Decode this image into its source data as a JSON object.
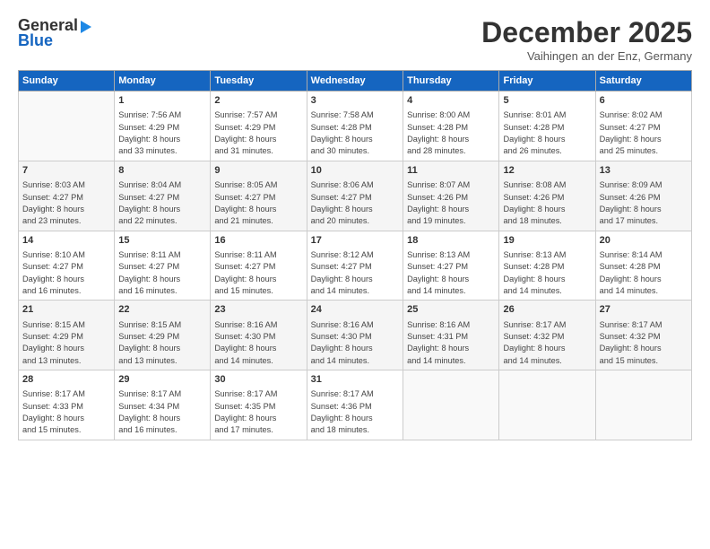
{
  "header": {
    "logo_top": "General",
    "logo_bottom": "Blue",
    "month": "December 2025",
    "location": "Vaihingen an der Enz, Germany"
  },
  "days_of_week": [
    "Sunday",
    "Monday",
    "Tuesday",
    "Wednesday",
    "Thursday",
    "Friday",
    "Saturday"
  ],
  "weeks": [
    [
      {
        "num": "",
        "info": ""
      },
      {
        "num": "1",
        "info": "Sunrise: 7:56 AM\nSunset: 4:29 PM\nDaylight: 8 hours\nand 33 minutes."
      },
      {
        "num": "2",
        "info": "Sunrise: 7:57 AM\nSunset: 4:29 PM\nDaylight: 8 hours\nand 31 minutes."
      },
      {
        "num": "3",
        "info": "Sunrise: 7:58 AM\nSunset: 4:28 PM\nDaylight: 8 hours\nand 30 minutes."
      },
      {
        "num": "4",
        "info": "Sunrise: 8:00 AM\nSunset: 4:28 PM\nDaylight: 8 hours\nand 28 minutes."
      },
      {
        "num": "5",
        "info": "Sunrise: 8:01 AM\nSunset: 4:28 PM\nDaylight: 8 hours\nand 26 minutes."
      },
      {
        "num": "6",
        "info": "Sunrise: 8:02 AM\nSunset: 4:27 PM\nDaylight: 8 hours\nand 25 minutes."
      }
    ],
    [
      {
        "num": "7",
        "info": "Sunrise: 8:03 AM\nSunset: 4:27 PM\nDaylight: 8 hours\nand 23 minutes."
      },
      {
        "num": "8",
        "info": "Sunrise: 8:04 AM\nSunset: 4:27 PM\nDaylight: 8 hours\nand 22 minutes."
      },
      {
        "num": "9",
        "info": "Sunrise: 8:05 AM\nSunset: 4:27 PM\nDaylight: 8 hours\nand 21 minutes."
      },
      {
        "num": "10",
        "info": "Sunrise: 8:06 AM\nSunset: 4:27 PM\nDaylight: 8 hours\nand 20 minutes."
      },
      {
        "num": "11",
        "info": "Sunrise: 8:07 AM\nSunset: 4:26 PM\nDaylight: 8 hours\nand 19 minutes."
      },
      {
        "num": "12",
        "info": "Sunrise: 8:08 AM\nSunset: 4:26 PM\nDaylight: 8 hours\nand 18 minutes."
      },
      {
        "num": "13",
        "info": "Sunrise: 8:09 AM\nSunset: 4:26 PM\nDaylight: 8 hours\nand 17 minutes."
      }
    ],
    [
      {
        "num": "14",
        "info": "Sunrise: 8:10 AM\nSunset: 4:27 PM\nDaylight: 8 hours\nand 16 minutes."
      },
      {
        "num": "15",
        "info": "Sunrise: 8:11 AM\nSunset: 4:27 PM\nDaylight: 8 hours\nand 16 minutes."
      },
      {
        "num": "16",
        "info": "Sunrise: 8:11 AM\nSunset: 4:27 PM\nDaylight: 8 hours\nand 15 minutes."
      },
      {
        "num": "17",
        "info": "Sunrise: 8:12 AM\nSunset: 4:27 PM\nDaylight: 8 hours\nand 14 minutes."
      },
      {
        "num": "18",
        "info": "Sunrise: 8:13 AM\nSunset: 4:27 PM\nDaylight: 8 hours\nand 14 minutes."
      },
      {
        "num": "19",
        "info": "Sunrise: 8:13 AM\nSunset: 4:28 PM\nDaylight: 8 hours\nand 14 minutes."
      },
      {
        "num": "20",
        "info": "Sunrise: 8:14 AM\nSunset: 4:28 PM\nDaylight: 8 hours\nand 14 minutes."
      }
    ],
    [
      {
        "num": "21",
        "info": "Sunrise: 8:15 AM\nSunset: 4:29 PM\nDaylight: 8 hours\nand 13 minutes."
      },
      {
        "num": "22",
        "info": "Sunrise: 8:15 AM\nSunset: 4:29 PM\nDaylight: 8 hours\nand 13 minutes."
      },
      {
        "num": "23",
        "info": "Sunrise: 8:16 AM\nSunset: 4:30 PM\nDaylight: 8 hours\nand 14 minutes."
      },
      {
        "num": "24",
        "info": "Sunrise: 8:16 AM\nSunset: 4:30 PM\nDaylight: 8 hours\nand 14 minutes."
      },
      {
        "num": "25",
        "info": "Sunrise: 8:16 AM\nSunset: 4:31 PM\nDaylight: 8 hours\nand 14 minutes."
      },
      {
        "num": "26",
        "info": "Sunrise: 8:17 AM\nSunset: 4:32 PM\nDaylight: 8 hours\nand 14 minutes."
      },
      {
        "num": "27",
        "info": "Sunrise: 8:17 AM\nSunset: 4:32 PM\nDaylight: 8 hours\nand 15 minutes."
      }
    ],
    [
      {
        "num": "28",
        "info": "Sunrise: 8:17 AM\nSunset: 4:33 PM\nDaylight: 8 hours\nand 15 minutes."
      },
      {
        "num": "29",
        "info": "Sunrise: 8:17 AM\nSunset: 4:34 PM\nDaylight: 8 hours\nand 16 minutes."
      },
      {
        "num": "30",
        "info": "Sunrise: 8:17 AM\nSunset: 4:35 PM\nDaylight: 8 hours\nand 17 minutes."
      },
      {
        "num": "31",
        "info": "Sunrise: 8:17 AM\nSunset: 4:36 PM\nDaylight: 8 hours\nand 18 minutes."
      },
      {
        "num": "",
        "info": ""
      },
      {
        "num": "",
        "info": ""
      },
      {
        "num": "",
        "info": ""
      }
    ]
  ]
}
